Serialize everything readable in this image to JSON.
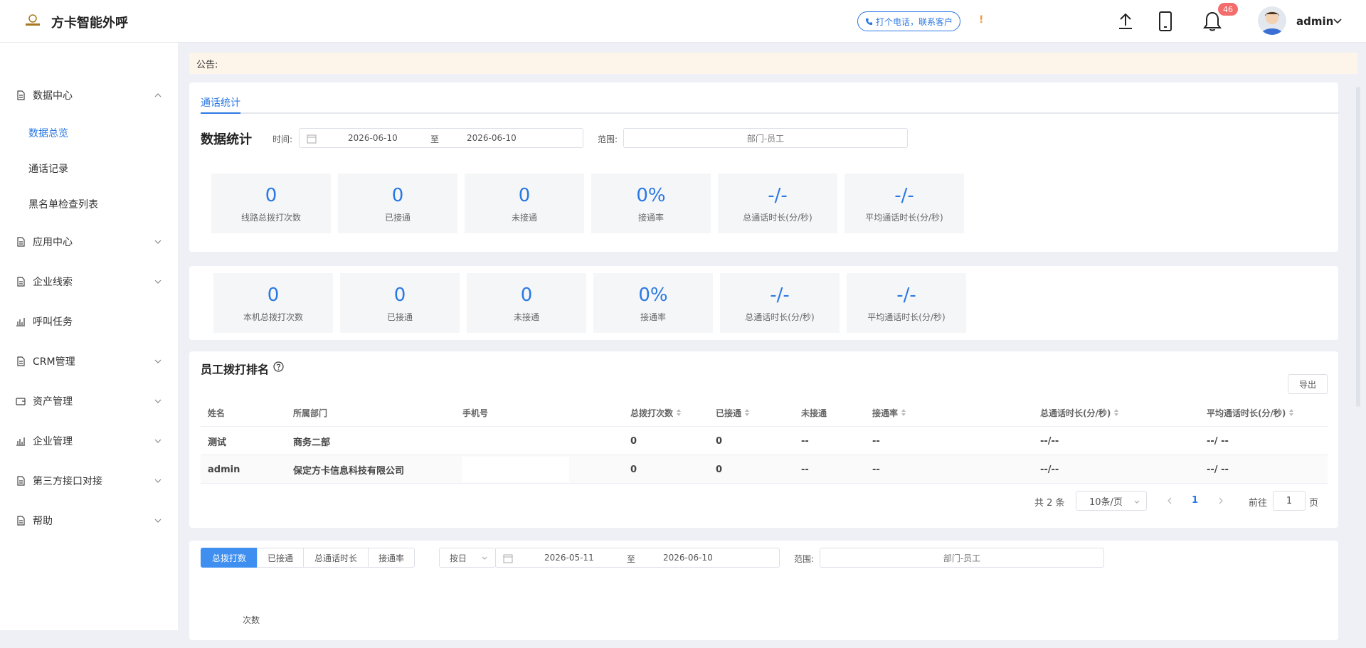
{
  "header": {
    "app_title": "方卡智能外呼",
    "call_button": "打个电话，联系客户",
    "warning": "!",
    "notification_count": "46",
    "user_name": "admin"
  },
  "sidebar": {
    "menu": [
      {
        "label": "数据中心",
        "expanded": true
      },
      {
        "label": "应用中心"
      },
      {
        "label": "企业线索"
      },
      {
        "label": "呼叫任务"
      },
      {
        "label": "CRM管理"
      },
      {
        "label": "资产管理"
      },
      {
        "label": "企业管理"
      },
      {
        "label": "第三方接口对接"
      },
      {
        "label": "帮助"
      }
    ],
    "data_center_sub": [
      "数据总览",
      "通话记录",
      "黑名单检查列表"
    ]
  },
  "notice": {
    "label": "公告:"
  },
  "stats_card": {
    "tab": "通话统计",
    "title": "数据统计",
    "time_label": "时间:",
    "start_date": "2026-06-10",
    "to": "至",
    "end_date": "2026-06-10",
    "range_label": "范围:",
    "range_placeholder": "部门-员工",
    "line_stats": [
      {
        "value": "0",
        "label": "线路总拨打次数"
      },
      {
        "value": "0",
        "label": "已接通"
      },
      {
        "value": "0",
        "label": "未接通"
      },
      {
        "value": "0%",
        "label": "接通率"
      },
      {
        "value": "-/-",
        "label": "总通话时长(分/秒)"
      },
      {
        "value": "-/-",
        "label": "平均通话时长(分/秒)"
      }
    ]
  },
  "local_stats": [
    {
      "value": "0",
      "label": "本机总拨打次数"
    },
    {
      "value": "0",
      "label": "已接通"
    },
    {
      "value": "0",
      "label": "未接通"
    },
    {
      "value": "0%",
      "label": "接通率"
    },
    {
      "value": "-/-",
      "label": "总通话时长(分/秒)"
    },
    {
      "value": "-/-",
      "label": "平均通话时长(分/秒)"
    }
  ],
  "ranking": {
    "title": "员工拨打排名",
    "export": "导出",
    "columns": [
      "姓名",
      "所属部门",
      "手机号",
      "总拨打次数",
      "已接通",
      "未接通",
      "接通率",
      "总通话时长(分/秒)",
      "平均通话时长(分/秒)"
    ],
    "rows": [
      [
        "测试",
        "商务二部",
        "",
        "0",
        "0",
        "--",
        "--",
        "--/--",
        "--/ --"
      ],
      [
        "admin",
        "保定方卡信息科技有限公司",
        "",
        "0",
        "0",
        "--",
        "--",
        "--/--",
        "--/ --"
      ]
    ],
    "pager": {
      "total": "共 2 条",
      "page_size": "10条/页",
      "current": "1",
      "goto": "前往",
      "goto_value": "1",
      "page_suffix": "页"
    }
  },
  "trend": {
    "segments": [
      "总拨打数",
      "已接通",
      "总通话时长",
      "接通率"
    ],
    "granularity": "按日",
    "start_date": "2026-05-11",
    "to": "至",
    "end_date": "2026-06-10",
    "range_label": "范围:",
    "range_placeholder": "部门-员工",
    "y_unit": "次数"
  }
}
